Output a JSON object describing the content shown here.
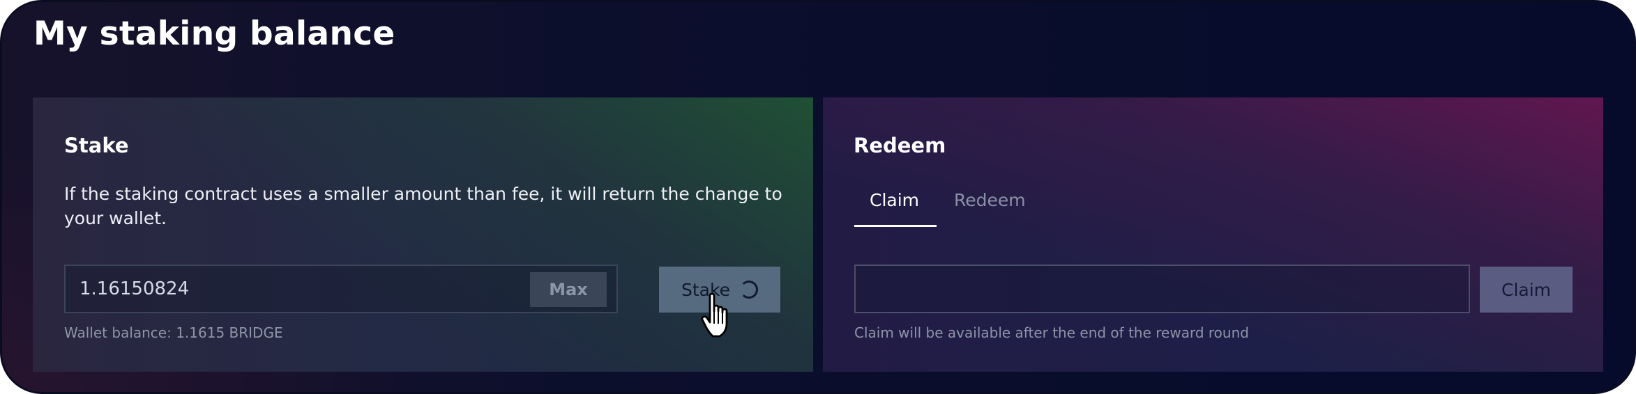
{
  "page": {
    "title": "My staking balance"
  },
  "stake": {
    "title": "Stake",
    "description": "If the staking contract uses a smaller amount than fee, it will return the change to your wallet.",
    "amount_value": "1.16150824",
    "max_label": "Max",
    "button_label": "Stake",
    "wallet_balance": "Wallet balance: 1.1615 BRIDGE",
    "loading": true
  },
  "redeem": {
    "title": "Redeem",
    "tabs": [
      {
        "label": "Claim",
        "active": true
      },
      {
        "label": "Redeem",
        "active": false
      }
    ],
    "input_value": "",
    "button_label": "Claim",
    "hint": "Claim will be available after the end of the reward round"
  },
  "icons": {
    "spinner": "loading-spinner-icon",
    "cursor": "hand-pointer-cursor-icon"
  },
  "colors": {
    "stake_button": "#566a80",
    "claim_button": "#5a5c82",
    "max_button": "#3a4658",
    "background": "#060b2c"
  }
}
